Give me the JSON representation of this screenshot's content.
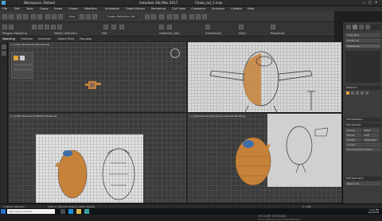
{
  "app": {
    "title": "Autodesk 3ds Max 2017",
    "doc": "Workspace: Default",
    "file": "Chaos_tut_1.max"
  },
  "menu": [
    "File",
    "Edit",
    "Tools",
    "Group",
    "Views",
    "Create",
    "Modifiers",
    "Animation",
    "Graph Editors",
    "Rendering",
    "Civil View",
    "Customize",
    "Scripting",
    "Content",
    "Help"
  ],
  "toolbar": {
    "selection_set": "Create Selection Set",
    "view_dropdown": "View"
  },
  "ribbon": [
    "Modeling",
    "Freeform",
    "Selection",
    "Object Paint",
    "Populate"
  ],
  "ribbon_groups": [
    "Polygon Modeling",
    "Modify Selection",
    "Edit",
    "Geometry (All)",
    "Subdivision",
    "Align",
    "Properties"
  ],
  "viewports": {
    "top": "[+] [Top] [Standard] [Wireframe]",
    "front": "[+] [Front] [Standard] [Default Shading]",
    "left": "[+] [Left] [Standard] [Default Shading]",
    "persp": "[+] [Perspective] [Standard] [Default Shading]"
  },
  "cmdpanel": {
    "object": "Chaos_Body",
    "modifier_list": "Modifier List",
    "stack": [
      "Editable Poly"
    ],
    "selection": "Selection",
    "soft_selection": "Soft Selection",
    "edit_vertices": "Edit Vertices",
    "edit_geometry": "Edit Geometry",
    "remove": "Remove",
    "break": "Break",
    "extrude": "Extrude",
    "weld": "Weld",
    "chamfer": "Chamfer",
    "target_weld": "Target Weld",
    "connect": "Connect",
    "remove_isolated": "Remove Isolated Vertices",
    "repeat_last": "Repeat Last"
  },
  "status": {
    "selected": "1 Object Selected",
    "prompt": "Click or click-and-drag to select objects",
    "frame": "0 / 100"
  },
  "taskbar": {
    "search_placeholder": "Type here to search",
    "time": "3:31 PM",
    "date": "2/2/2018"
  },
  "watermark": {
    "line1": "Activate Windows",
    "line2": "Go to Settings to activate Windows."
  },
  "colors": {
    "selected": "#e0a23a",
    "bg": "#3b3b3b",
    "accent": "#2a6fc9"
  }
}
